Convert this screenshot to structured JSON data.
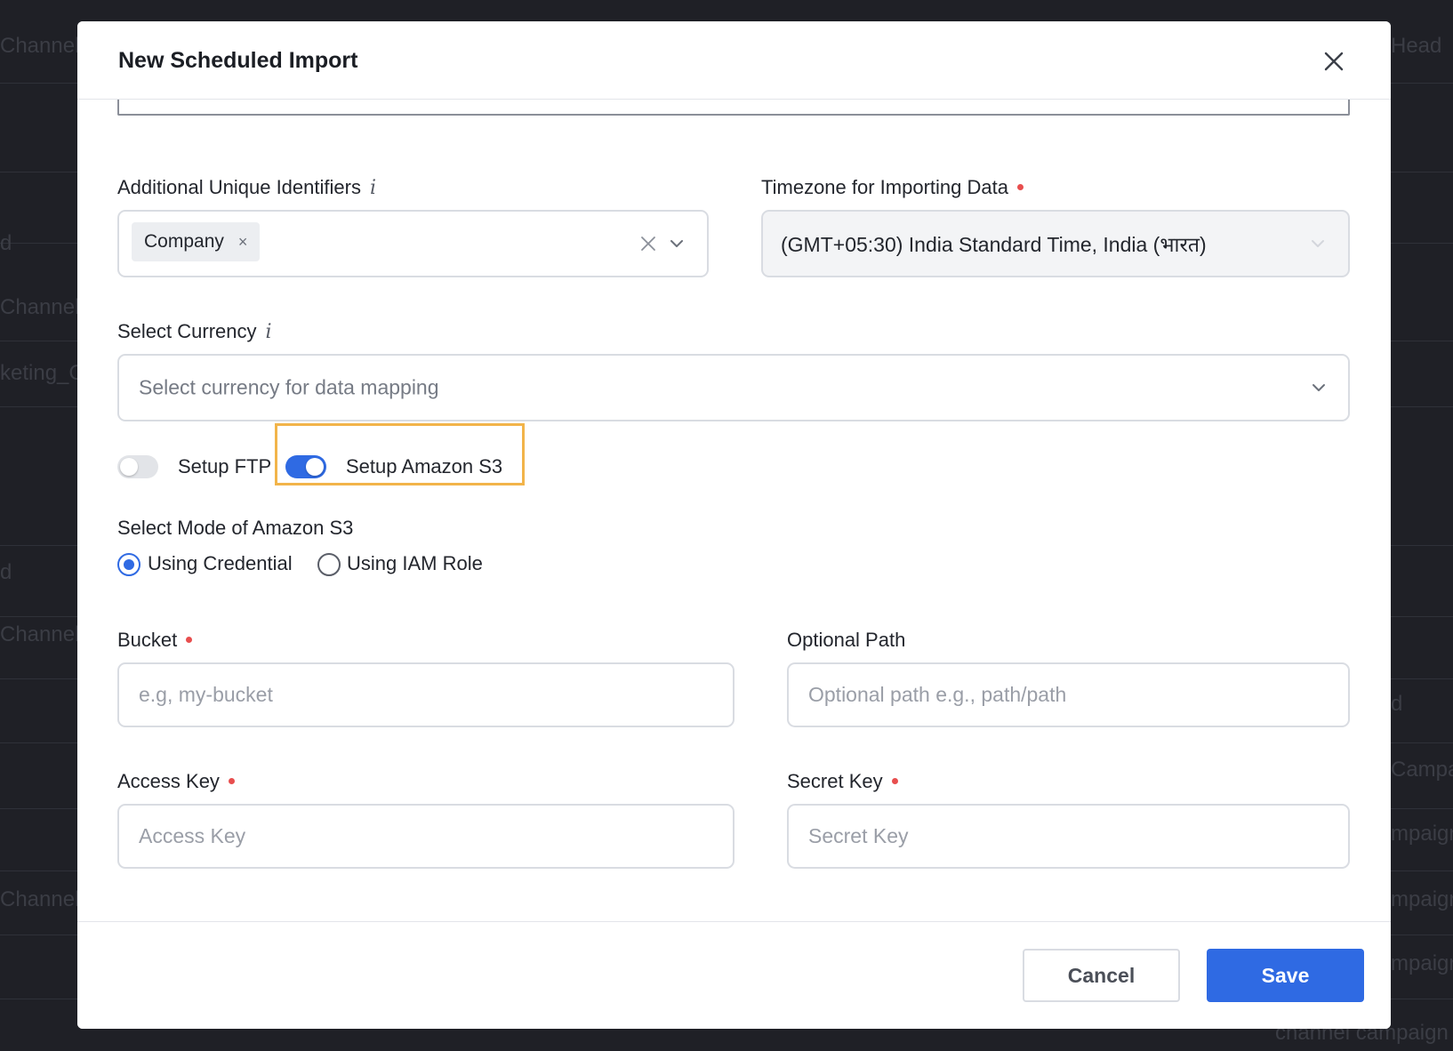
{
  "background": {
    "rows": [
      {
        "left": "Channel",
        "right": "Head"
      },
      {
        "left": "d",
        "right": ""
      },
      {
        "left": "Channel",
        "right": ""
      },
      {
        "left": "keting_C",
        "right": ""
      },
      {
        "left": "d",
        "right": ""
      },
      {
        "left": "Channel",
        "right": ""
      },
      {
        "left": "",
        "right": "d"
      },
      {
        "left": "",
        "right": "Campa"
      },
      {
        "left": "",
        "right": "mpaign"
      },
      {
        "left": "Channel",
        "right": "mpaign"
      },
      {
        "left": "",
        "right": "mpaign"
      },
      {
        "left": "",
        "right": "channel campaign"
      }
    ]
  },
  "modal": {
    "title": "New Scheduled Import",
    "fields": {
      "unique_identifiers": {
        "label": "Additional Unique Identifiers",
        "info": "i",
        "chip": "Company",
        "chip_remove": "×"
      },
      "timezone": {
        "label": "Timezone for Importing Data",
        "value": "(GMT+05:30) India Standard Time, India (भारत)"
      },
      "currency": {
        "label": "Select Currency",
        "info": "i",
        "placeholder": "Select currency for data mapping"
      },
      "toggles": {
        "ftp": {
          "label": "Setup FTP",
          "on": false
        },
        "s3": {
          "label": "Setup Amazon S3",
          "on": true
        }
      },
      "s3_mode": {
        "label": "Select Mode of Amazon S3",
        "options": [
          {
            "label": "Using Credential",
            "selected": true
          },
          {
            "label": "Using IAM Role",
            "selected": false
          }
        ]
      },
      "bucket": {
        "label": "Bucket",
        "placeholder": "e.g, my-bucket"
      },
      "optional_path": {
        "label": "Optional Path",
        "placeholder": "Optional path e.g., path/path"
      },
      "access_key": {
        "label": "Access Key",
        "placeholder": "Access Key"
      },
      "secret_key": {
        "label": "Secret Key",
        "placeholder": "Secret Key"
      }
    },
    "footer": {
      "cancel_label": "Cancel",
      "save_label": "Save"
    }
  },
  "colors": {
    "accent": "#2f6ae3",
    "required": "#e84e4e",
    "highlight": "#f2b44a",
    "backdrop": "#1f2026"
  }
}
